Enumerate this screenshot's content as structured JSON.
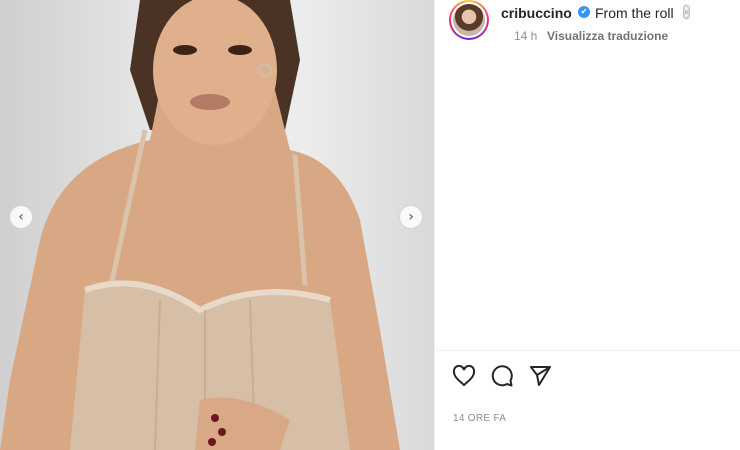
{
  "post": {
    "username": "cribuccino",
    "caption": "From the roll",
    "time_short": "14 h",
    "translate_label": "Visualizza traduzione",
    "time_long": "14 ORE FA"
  },
  "icons": {
    "verified": "verified-badge-icon",
    "link": "link-icon",
    "like": "heart-icon",
    "comment": "comment-icon",
    "share": "send-icon",
    "prev": "chevron-left-icon",
    "next": "chevron-right-icon"
  },
  "colors": {
    "verified_blue": "#3897f0",
    "muted_text": "#8e8e8e",
    "primary_text": "#262626"
  }
}
